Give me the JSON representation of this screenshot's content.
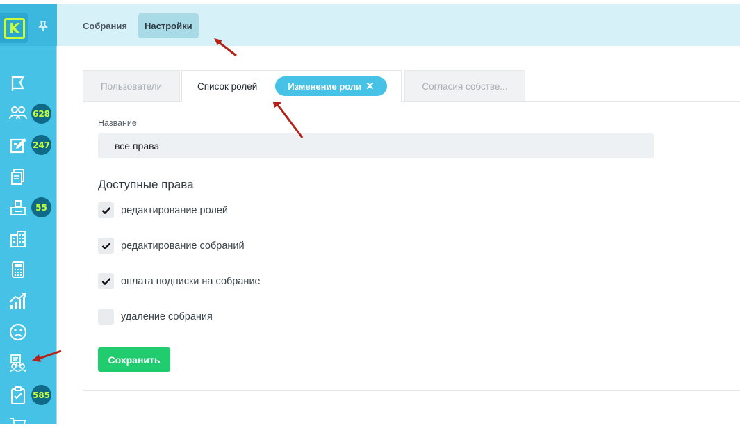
{
  "app": {
    "logo_letter": "K"
  },
  "colors": {
    "sidebar": "#46c2e6",
    "header": "#d6f2f8",
    "accent_pill": "#46c2e6",
    "save_button": "#21cc6e",
    "badge": "#0f6a88",
    "badge_text": "#c8ff3a",
    "annotation_arrow": "#b3231a"
  },
  "sidebar": {
    "pin_icon": "pin-icon",
    "items": [
      {
        "icon": "flag-icon",
        "badge": ""
      },
      {
        "icon": "people-icon",
        "badge": "628"
      },
      {
        "icon": "edit-document-icon",
        "badge": "247"
      },
      {
        "icon": "documents-icon",
        "badge": ""
      },
      {
        "icon": "voting-box-icon",
        "badge": "55"
      },
      {
        "icon": "building-icon",
        "badge": ""
      },
      {
        "icon": "calculator-icon",
        "badge": ""
      },
      {
        "icon": "chart-icon",
        "badge": ""
      },
      {
        "icon": "sad-face-icon",
        "badge": ""
      },
      {
        "icon": "users-settings-icon",
        "badge": ""
      },
      {
        "icon": "clipboard-check-icon",
        "badge": "585"
      },
      {
        "icon": "cart-icon",
        "badge": ""
      }
    ]
  },
  "header": {
    "tabs": [
      {
        "label": "Собрания",
        "active": false
      },
      {
        "label": "Настройки",
        "active": true
      }
    ]
  },
  "settings_tabs": [
    {
      "label": "Пользователи",
      "active": false
    },
    {
      "label": "Список ролей",
      "active": true
    },
    {
      "label": "Изменение роли",
      "closable": true
    },
    {
      "label": "Согласия собстве...",
      "active": false
    }
  ],
  "form": {
    "name_label": "Название",
    "name_value": "все права",
    "rights_title": "Доступные права",
    "permissions": [
      {
        "label": "редактирование ролей",
        "checked": true
      },
      {
        "label": "редактирование собраний",
        "checked": true
      },
      {
        "label": "оплата подписки на собрание",
        "checked": true
      },
      {
        "label": "удаление собрания",
        "checked": false
      }
    ],
    "save_label": "Сохранить"
  }
}
